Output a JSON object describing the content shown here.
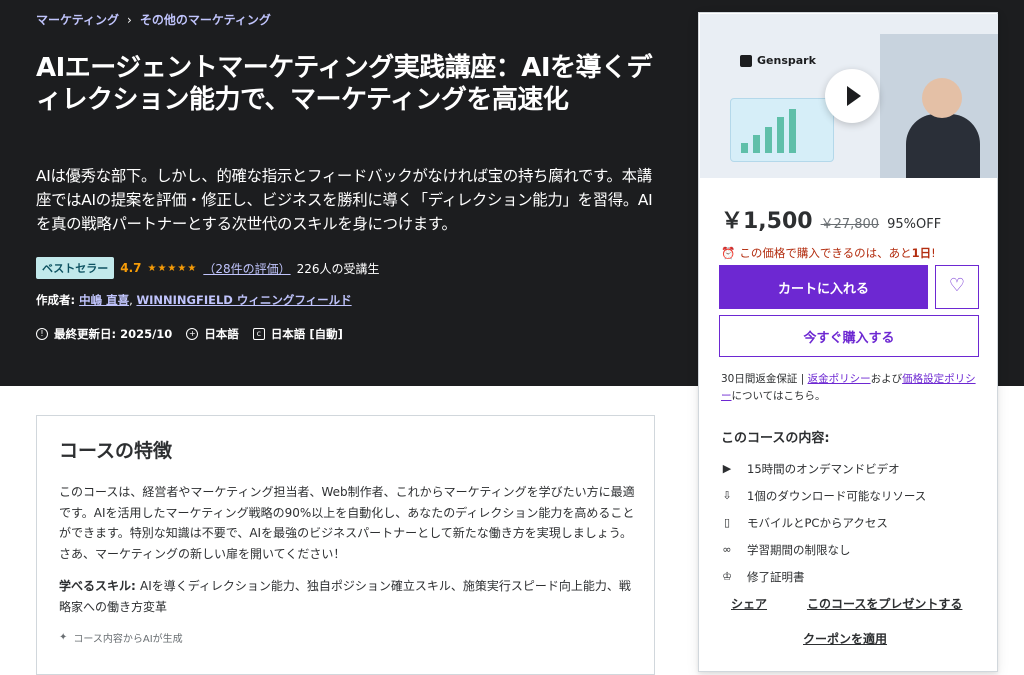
{
  "breadcrumb": [
    "マーケティング",
    "その他のマーケティング"
  ],
  "course": {
    "title": "AIエージェントマーケティング実践講座：AIを導くディレクション能力で、マーケティングを高速化",
    "subtitle": "AIは優秀な部下。しかし、的確な指示とフィードバックがなければ宝の持ち腐れです。本講座ではAIの提案を評価・修正し、ビジネスを勝利に導く「ディレクション能力」を習得。AIを真の戦略パートナーとする次世代のスキルを身につけます。",
    "badge": "ベストセラー",
    "rating": "4.7",
    "rating_count": "（28件の評価）",
    "students": "226人の受講生",
    "author_label": "作成者: ",
    "authors": [
      "中嶋 直喜",
      "WINNINGFIELD ウィニングフィールド"
    ],
    "updated": "最終更新日: 2025/10",
    "language": "日本語",
    "captions": "日本語 [自動]"
  },
  "preview": {
    "brand": "Genspark",
    "play_icon": "play-icon"
  },
  "purchase": {
    "price": "￥1,500",
    "original_price": "￥27,800",
    "discount": "95%OFF",
    "timer_prefix": "この価格で購入できるのは、あと",
    "timer_value": "1日",
    "timer_suffix": "!",
    "cart_label": "カートに入れる",
    "buy_label": "今すぐ購入する",
    "guarantee_text": "30日間返金保証 | ",
    "refund_link": "返金ポリシー",
    "and_text": "および",
    "pricing_link": "価格設定ポリシー",
    "tail_text": "についてはこちら。"
  },
  "includes": {
    "title": "このコースの内容:",
    "items": [
      {
        "icon": "video-icon",
        "label": "15時間のオンデマンドビデオ"
      },
      {
        "icon": "file-download-icon",
        "label": "1個のダウンロード可能なリソース"
      },
      {
        "icon": "mobile-icon",
        "label": "モバイルとPCからアクセス"
      },
      {
        "icon": "infinity-icon",
        "label": "学習期間の制限なし"
      },
      {
        "icon": "trophy-icon",
        "label": "修了証明書"
      }
    ]
  },
  "actions": {
    "share": "シェア",
    "gift": "このコースをプレゼントする",
    "coupon": "クーポンを適用"
  },
  "features": {
    "title": "コースの特徴",
    "description": "このコースは、経営者やマーケティング担当者、Web制作者、これからマーケティングを学びたい方に最適です。AIを活用したマーケティング戦略の90%以上を自動化し、あなたのディレクション能力を高めることができます。特別な知識は不要で、AIを最強のビジネスパートナーとして新たな働き方を実現しましょう。さあ、マーケティングの新しい扉を開いてください！",
    "skills_label": "学べるスキル: ",
    "skills": "AIを導くディレクション能力、独自ポジション確立スキル、施策実行スピード向上能力、戦略家への働き方変革",
    "ai_note": "コース内容からAIが生成"
  }
}
